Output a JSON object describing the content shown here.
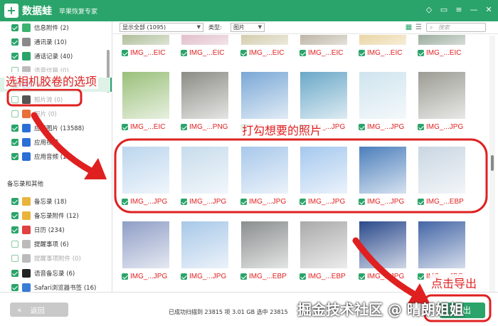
{
  "titlebar": {
    "app_name": "数据蛙",
    "subtitle": "苹果恢复专家",
    "logo_mark": "+",
    "icons": [
      "diamond-icon",
      "chat-icon",
      "menu-icon",
      "minimize-icon",
      "close-icon"
    ],
    "icon_glyphs": [
      "◇",
      "▭",
      "≡",
      "—",
      "✕"
    ]
  },
  "sidebar": {
    "items": [
      {
        "label": "信息附件 (2)",
        "checked": true,
        "icon_color": "#3cb371",
        "grey": false
      },
      {
        "label": "通讯录 (10)",
        "checked": true,
        "icon_color": "#8a8a8a",
        "grey": false
      },
      {
        "label": "通话记录 (40)",
        "checked": true,
        "icon_color": "#2aa46a",
        "grey": false
      },
      {
        "label": "语音信箱 (0)",
        "checked": false,
        "icon_color": "#bbbbbb",
        "grey": true
      },
      {
        "label": "相机胶卷 (1216)",
        "checked": true,
        "icon_color": "#3a7bd5",
        "grey": false,
        "active": true
      },
      {
        "label": "照片流 (0)",
        "checked": false,
        "icon_color": "#555555",
        "grey": true
      },
      {
        "label": "照片 (0)",
        "checked": false,
        "icon_color": "#e8703a",
        "grey": true
      },
      {
        "label": "应用图片 (13588)",
        "checked": true,
        "icon_color": "#2b6fd6",
        "grey": false
      },
      {
        "label": "应用视频",
        "checked": true,
        "icon_color": "#2b6fd6",
        "grey": false
      },
      {
        "label": "应用音频 (15)",
        "checked": true,
        "icon_color": "#2b6fd6",
        "grey": false
      }
    ],
    "section_title": "备忘录和其他",
    "items2": [
      {
        "label": "备忘录 (18)",
        "checked": true,
        "icon_color": "#e8b43a",
        "grey": false
      },
      {
        "label": "备忘录附件 (12)",
        "checked": true,
        "icon_color": "#e8b43a",
        "grey": false
      },
      {
        "label": "日历 (234)",
        "checked": true,
        "icon_color": "#e04040",
        "grey": false
      },
      {
        "label": "提醒事项 (6)",
        "checked": false,
        "icon_color": "#bbbbbb",
        "grey": false
      },
      {
        "label": "提醒事项附件 (0)",
        "checked": false,
        "icon_color": "#bbbbbb",
        "grey": true
      },
      {
        "label": "语音备忘录 (6)",
        "checked": true,
        "icon_color": "#222222",
        "grey": false
      },
      {
        "label": "Safari浏览器书签 (16)",
        "checked": true,
        "icon_color": "#3a7bd5",
        "grey": false
      }
    ]
  },
  "filter": {
    "show_value": "显示全部 (1095)",
    "type_label": "类型:",
    "type_value": "图片",
    "search_placeholder": "搜索",
    "search_icon": "search-icon",
    "grid_view_icon": "grid-view-icon",
    "list_view_icon": "list-view-icon"
  },
  "grid": {
    "rows": [
      {
        "names": [
          "IMG_...EIC",
          "IMG_...EIC",
          "IMG_...EIC",
          "IMG_...EIC",
          "IMG_...EIC",
          "IMG_...EIC"
        ],
        "checked": [
          true,
          true,
          true,
          true,
          true,
          true
        ]
      },
      {
        "names": [
          "IMG_...EIC",
          "IMG_...PNG",
          "IMG_...JPG",
          "IMG_...JPG",
          "IMG_...JPG",
          "IMG_...JPG"
        ],
        "checked": [
          true,
          true,
          true,
          true,
          true,
          true
        ]
      },
      {
        "names": [
          "IMG_...JPG",
          "IMG_...JPG",
          "IMG_...JPG",
          "IMG_...JPG",
          "IMG_...JPG",
          "IMG_...EBP"
        ],
        "checked": [
          true,
          true,
          true,
          true,
          true,
          true
        ]
      },
      {
        "names": [
          "IMG_...JPG",
          "IMG_...JPG",
          "IMG_...EBP",
          "IMG_...EBP",
          "IMG_...JPG",
          "IMG_...JPG"
        ],
        "checked": [
          true,
          true,
          true,
          true,
          true,
          true
        ]
      }
    ],
    "thumb_colors": [
      [
        "#6f8a4a",
        "#c98aa0",
        "#b0a36c",
        "#8a7a5e",
        "#d9b35a",
        "#4d6a52"
      ],
      [
        "#9ac07a",
        "#8c8c86",
        "#7aa8d6",
        "#6aa8c8",
        "#cfe4ee",
        "#9c9c94"
      ],
      [
        "#bcd6ee",
        "#c7dcec",
        "#a8c8ea",
        "#a5c8ee",
        "#4c7fbc",
        "#c9d6e2"
      ],
      [
        "#8f9ec6",
        "#a8c8e8",
        "#8a8e8e",
        "#aaaaaa",
        "#2b4a8c",
        "#4466a6"
      ]
    ]
  },
  "bottom": {
    "back_label": "返回",
    "back_icon": "double-chevron-left-icon",
    "status_text": "已成功扫描到 23815 项 3.01 GB  选中 23815",
    "export_label": "导出"
  },
  "annotations": {
    "select_camera_roll": "选相机胶卷的选项",
    "check_photos": "打勾想要的照片",
    "click_export": "点击导出",
    "color": "#e02020"
  },
  "watermark": "掘金技术社区 @ 晴朗姐姐"
}
